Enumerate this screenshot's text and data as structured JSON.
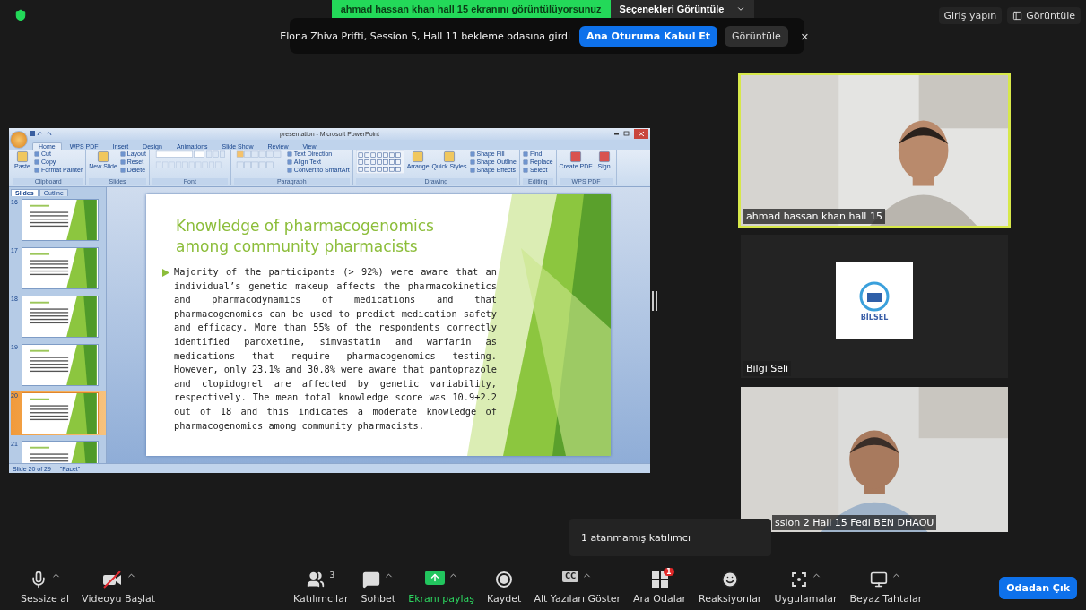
{
  "top_bar": {
    "sharing_banner": "ahmad hassan khan hall 15 ekranını görüntülüyorsunuz",
    "view_options": "Seçenekleri Görüntüle",
    "sign_in": "Giriş yapın",
    "view": "Görüntüle"
  },
  "notification": {
    "message": "Elona Zhiva Prifti, Session 5, Hall 11 bekleme odasına girdi",
    "admit": "Ana Oturuma Kabul Et",
    "view": "Görüntüle",
    "close": "×"
  },
  "shared_screen": {
    "window_title": "presentation - Microsoft PowerPoint",
    "ribbon_tabs": [
      {
        "label": "Home",
        "selected": true
      },
      {
        "label": "WPS PDF",
        "selected": false
      },
      {
        "label": "Insert",
        "selected": false
      },
      {
        "label": "Design",
        "selected": false
      },
      {
        "label": "Animations",
        "selected": false
      },
      {
        "label": "Slide Show",
        "selected": false
      },
      {
        "label": "Review",
        "selected": false
      },
      {
        "label": "View",
        "selected": false
      }
    ],
    "ribbon_groups": [
      {
        "label": "Clipboard",
        "items": [
          {
            "kind": "large",
            "label": "Paste"
          },
          {
            "kind": "small",
            "label": "Cut"
          },
          {
            "kind": "small",
            "label": "Copy"
          },
          {
            "kind": "small",
            "label": "Format Painter"
          }
        ]
      },
      {
        "label": "Slides",
        "items": [
          {
            "kind": "large",
            "label": "New Slide"
          },
          {
            "kind": "small",
            "label": "Layout"
          },
          {
            "kind": "small",
            "label": "Reset"
          },
          {
            "kind": "small",
            "label": "Delete"
          }
        ]
      },
      {
        "label": "Font",
        "items": [
          {
            "kind": "font"
          }
        ]
      },
      {
        "label": "Paragraph",
        "items": [
          {
            "kind": "paragraph"
          },
          {
            "kind": "small",
            "label": "Text Direction"
          },
          {
            "kind": "small",
            "label": "Align Text"
          },
          {
            "kind": "small",
            "label": "Convert to SmartArt"
          }
        ]
      },
      {
        "label": "Drawing",
        "items": [
          {
            "kind": "shapes"
          },
          {
            "kind": "large",
            "label": "Arrange"
          },
          {
            "kind": "large",
            "label": "Quick Styles"
          },
          {
            "kind": "small",
            "label": "Shape Fill"
          },
          {
            "kind": "small",
            "label": "Shape Outline"
          },
          {
            "kind": "small",
            "label": "Shape Effects"
          }
        ]
      },
      {
        "label": "Editing",
        "items": [
          {
            "kind": "small",
            "label": "Find"
          },
          {
            "kind": "small",
            "label": "Replace"
          },
          {
            "kind": "small",
            "label": "Select"
          }
        ]
      },
      {
        "label": "WPS PDF",
        "items": [
          {
            "kind": "large",
            "label": "Create PDF"
          },
          {
            "kind": "large",
            "label": "Sign"
          }
        ]
      }
    ],
    "pane_tabs": [
      {
        "label": "Slides",
        "selected": true
      },
      {
        "label": "Outline",
        "selected": false
      }
    ],
    "thumbnails": [
      {
        "number": "16",
        "selected": false
      },
      {
        "number": "17",
        "selected": false
      },
      {
        "number": "18",
        "selected": false
      },
      {
        "number": "19",
        "selected": false
      },
      {
        "number": "20",
        "selected": true
      },
      {
        "number": "21",
        "selected": false
      }
    ],
    "slide": {
      "title": "Knowledge of pharmacogenomics among community pharmacists",
      "body": "Majority of the participants (> 92%) were aware that an individual’s genetic makeup affects the pharmacokinetics and pharmacodynamics of medications and that pharmacogenomics can be used to predict medication safety and efficacy. More than 55% of the respondents correctly identified paroxetine, simvastatin and warfarin as medications that require pharmacogenomics testing. However, only 23.1% and 30.8% were aware that pantoprazole and clopidogrel are affected by genetic variability, respectively. The mean total knowledge score was 10.9±2.2 out of 18 and this indicates a moderate knowledge of pharmacogenomics among community pharmacists."
    },
    "status_bar": {
      "slide_count": "Slide 20 of 29",
      "theme": "\"Facet\""
    }
  },
  "videos": [
    {
      "name": "ahmad hassan khan hall 15",
      "kind": "camera",
      "active": true
    },
    {
      "name": "Bilgi Seli",
      "kind": "logo",
      "logo_text": "BİLSEL",
      "active": false
    },
    {
      "name": "ssion 2 Hall 15 Fedi BEN DHAOU",
      "kind": "camera",
      "active": false
    }
  ],
  "tooltip": "1 atanmamış katılımcı",
  "toolbar": [
    {
      "kind": "mic",
      "label": "Sessize al",
      "caret": true
    },
    {
      "kind": "video",
      "label": "Videoyu Başlat",
      "caret": true,
      "off": true
    },
    {
      "kind": "people",
      "label": "Katılımcılar",
      "caret": false,
      "count": "3"
    },
    {
      "kind": "chat",
      "label": "Sohbet",
      "caret": true
    },
    {
      "kind": "share",
      "label": "Ekranı paylaş",
      "caret": true
    },
    {
      "kind": "record",
      "label": "Kaydet",
      "caret": false
    },
    {
      "kind": "cc",
      "label": "Alt Yazıları Göster",
      "caret": true,
      "icon_text": "CC"
    },
    {
      "kind": "rooms",
      "label": "Ara Odalar",
      "caret": false,
      "badge": "1"
    },
    {
      "kind": "reaction",
      "label": "Reaksiyonlar",
      "caret": false
    },
    {
      "kind": "apps",
      "label": "Uygulamalar",
      "caret": true
    },
    {
      "kind": "whiteboard",
      "label": "Beyaz Tahtalar",
      "caret": true
    }
  ],
  "leave_button": "Odadan Çık"
}
